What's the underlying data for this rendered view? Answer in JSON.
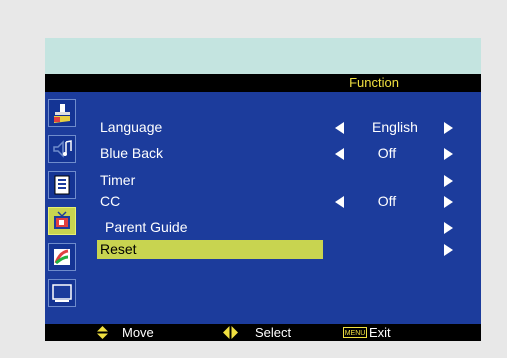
{
  "header": {
    "title": "Function"
  },
  "sidebar": {
    "icons": [
      {
        "name": "picture-adjust-icon",
        "active": false
      },
      {
        "name": "audio-icon",
        "active": false
      },
      {
        "name": "channel-list-icon",
        "active": false
      },
      {
        "name": "tv-function-icon",
        "active": true
      },
      {
        "name": "color-setup-icon",
        "active": false
      },
      {
        "name": "display-icon",
        "active": false
      }
    ]
  },
  "menu": {
    "items": [
      {
        "label": "Language",
        "value": "English",
        "left_arrow": true,
        "right_arrow": true
      },
      {
        "label": "Blue Back",
        "value": "Off",
        "left_arrow": true,
        "right_arrow": true
      },
      {
        "label": "Timer",
        "value": "",
        "left_arrow": false,
        "right_arrow": true
      },
      {
        "label": "CC",
        "value": "Off",
        "left_arrow": true,
        "right_arrow": true
      },
      {
        "label": "Parent Guide",
        "value": "",
        "left_arrow": false,
        "right_arrow": true
      },
      {
        "label": "Reset",
        "value": "",
        "left_arrow": false,
        "right_arrow": true,
        "highlighted": true
      }
    ]
  },
  "footer": {
    "move_label": "Move",
    "select_label": "Select",
    "menu_key": "MENU",
    "exit_label": "Exit"
  },
  "colors": {
    "panel": "#1c3c9c",
    "highlight": "#c8d450",
    "title_text": "#f0e040",
    "top_band": "#c4e4e0"
  }
}
